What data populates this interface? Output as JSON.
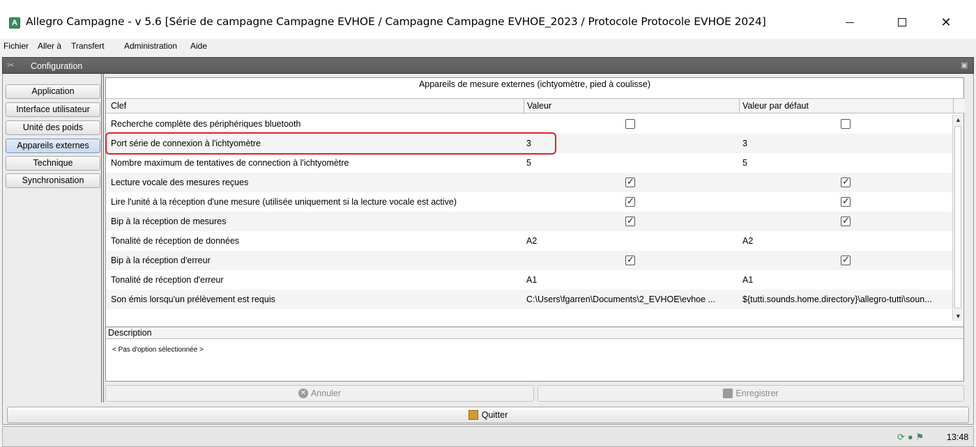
{
  "window": {
    "title": "Allegro Campagne - v 5.6 [Série de campagne Campagne EVHOE / Campagne Campagne EVHOE_2023 / Protocole Protocole EVHOE 2024]",
    "minimize": "—",
    "maximize": "☐",
    "close": "✕"
  },
  "menu": [
    "Fichier",
    "Aller à",
    "Transfert",
    "Administration",
    "Aide"
  ],
  "config": {
    "title": "Configuration"
  },
  "sidebar": {
    "tabs": [
      "Application",
      "Interface utilisateur",
      "Unité des poids",
      "Appareils externes",
      "Technique",
      "Synchronisation"
    ],
    "active_index": 3
  },
  "panel": {
    "caption": "Appareils de mesure externes (ichtyomètre, pied à coulisse)",
    "columns": [
      "Clef",
      "Valeur",
      "Valeur par défaut"
    ],
    "rows": [
      {
        "key": "Recherche complète des périphériques bluetooth",
        "value": "",
        "default": "",
        "value_checkbox": false,
        "default_checkbox": false,
        "is_checkbox": true
      },
      {
        "key": "Port série de connexion à l'ichtyomètre",
        "value": "3",
        "default": "3",
        "is_checkbox": false
      },
      {
        "key": "Nombre maximum de tentatives de connection à l'ichtyomètre",
        "value": "5",
        "default": "5",
        "is_checkbox": false
      },
      {
        "key": "Lecture vocale des mesures reçues",
        "value": "",
        "default": "",
        "value_checkbox": true,
        "default_checkbox": true,
        "is_checkbox": true
      },
      {
        "key": "Lire l'unité à la réception d'une mesure (utilisée uniquement si la lecture vocale est active)",
        "value": "",
        "default": "",
        "value_checkbox": true,
        "default_checkbox": true,
        "is_checkbox": true
      },
      {
        "key": "Bip à la réception de mesures",
        "value": "",
        "default": "",
        "value_checkbox": true,
        "default_checkbox": true,
        "is_checkbox": true
      },
      {
        "key": "Tonalité de réception de données",
        "value": "A2",
        "default": "A2",
        "is_checkbox": false
      },
      {
        "key": "Bip à la réception d'erreur",
        "value": "",
        "default": "",
        "value_checkbox": true,
        "default_checkbox": true,
        "is_checkbox": true
      },
      {
        "key": "Tonalité de réception d'erreur",
        "value": "A1",
        "default": "A1",
        "is_checkbox": false
      },
      {
        "key": "Son émis lorsqu'un prélèvement est requis",
        "value": "C:\\Users\\fgarren\\Documents\\2_EVHOE\\evhoe ...",
        "default": "${tutti.sounds.home.directory}\\allegro-tutti\\soun...",
        "is_checkbox": false
      }
    ],
    "highlighted_row": 1
  },
  "description": {
    "title": "Description",
    "text": "< Pas d'option sélectionnée >"
  },
  "buttons": {
    "cancel": "Annuler",
    "save": "Enregistrer",
    "quit": "Quitter"
  },
  "status": {
    "time": "13:48"
  },
  "colors": {
    "highlight": "#e0202a",
    "header": "#5e5e5e",
    "app_icon": "#3a8f5a"
  }
}
